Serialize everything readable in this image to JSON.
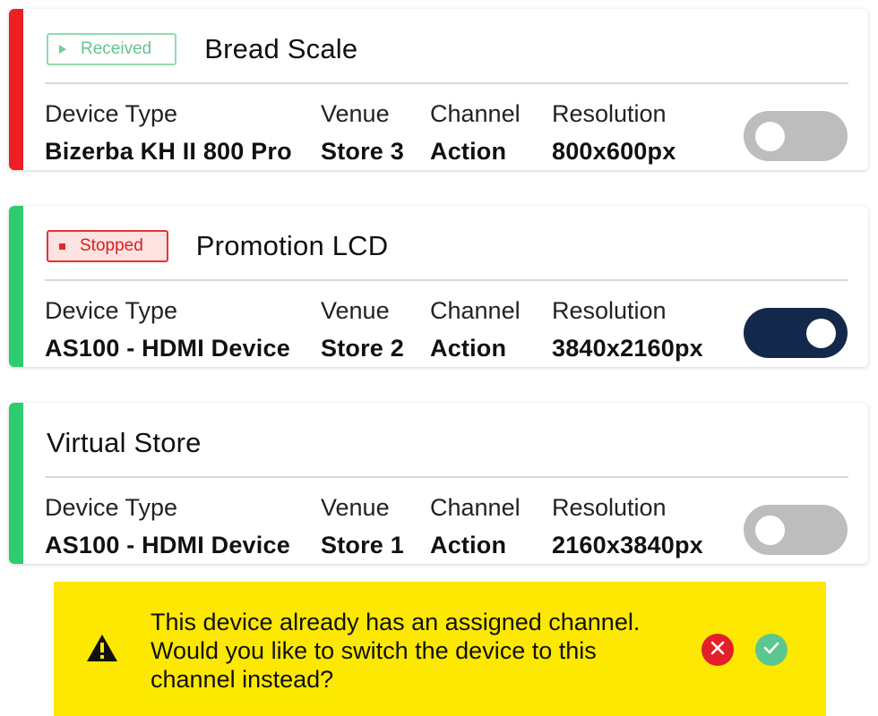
{
  "devices": [
    {
      "title": "Bread Scale",
      "status_label": "Received",
      "status_icon": "play-icon",
      "stripe_color": "#ee1f23",
      "enabled": false,
      "fields": [
        {
          "label": "Device Type",
          "value": "Bizerba KH II 800 Pro"
        },
        {
          "label": "Venue",
          "value": "Store 3"
        },
        {
          "label": "Channel",
          "value": "Action"
        },
        {
          "label": "Resolution",
          "value": "800x600px"
        }
      ]
    },
    {
      "title": "Promotion LCD",
      "status_label": "Stopped",
      "status_icon": "stop-icon",
      "stripe_color": "#2ecc71",
      "enabled": true,
      "fields": [
        {
          "label": "Device Type",
          "value": "AS100 - HDMI Device"
        },
        {
          "label": "Venue",
          "value": "Store 2"
        },
        {
          "label": "Channel",
          "value": "Action"
        },
        {
          "label": "Resolution",
          "value": "3840x2160px"
        }
      ]
    },
    {
      "title": "Virtual Store",
      "status_label": "",
      "stripe_color": "#2ecc71",
      "enabled": false,
      "fields": [
        {
          "label": "Device Type",
          "value": "AS100 - HDMI Device"
        },
        {
          "label": "Venue",
          "value": "Store 1"
        },
        {
          "label": "Channel",
          "value": "Action"
        },
        {
          "label": "Resolution",
          "value": "2160x3840px"
        }
      ]
    }
  ],
  "confirm_banner": {
    "message": "This device already has an assigned channel. Would you like to switch the device to this channel instead?",
    "icon": "warning-icon",
    "cancel_icon": "close-icon",
    "confirm_icon": "check-icon",
    "background": "#fce800"
  },
  "colors": {
    "toggle_on": "#14284c",
    "toggle_off": "#bdbdbd",
    "received": "#66c490",
    "stopped": "#e12a26"
  }
}
